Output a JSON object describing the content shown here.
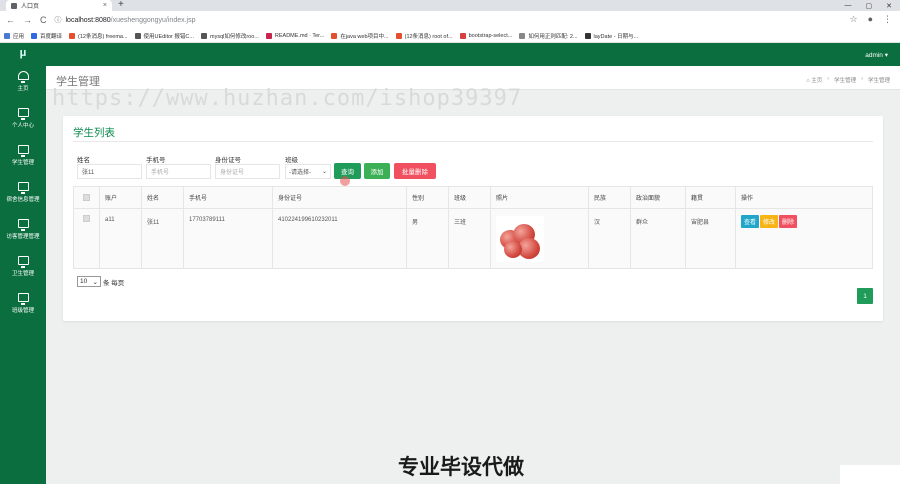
{
  "browser": {
    "tab_title": "人口页",
    "tab_close": "×",
    "new_tab": "+",
    "window_controls": [
      "—",
      "▢",
      "✕"
    ],
    "nav": [
      "←",
      "→",
      "C"
    ],
    "url_host": "localhost:8080",
    "url_path": "/xueshenggongyu/index.jsp",
    "addr_icons": [
      "☆",
      "●",
      "⋮"
    ],
    "bookmarks": [
      {
        "label": "应用",
        "color": "#4a7bd0"
      },
      {
        "label": "百度翻译",
        "color": "#2f6ae0"
      },
      {
        "label": "(12条消息) freema...",
        "color": "#e3502d"
      },
      {
        "label": "使用UEditor 报错C...",
        "color": "#555555"
      },
      {
        "label": "mysql如何修改roo...",
        "color": "#555555"
      },
      {
        "label": "README.md · Ter...",
        "color": "#c7254e"
      },
      {
        "label": "在java web项目中...",
        "color": "#e3502d"
      },
      {
        "label": "(12条消息) root of...",
        "color": "#e3502d"
      },
      {
        "label": "bootstrap-select...",
        "color": "#d64040"
      },
      {
        "label": "如何用正则匹配: 2...",
        "color": "#888888"
      },
      {
        "label": "layDate - 日期与...",
        "color": "#333333"
      }
    ]
  },
  "sidebar": {
    "logo": "μ",
    "items": [
      {
        "label": "主页"
      },
      {
        "label": "个人中心"
      },
      {
        "label": "学生管理"
      },
      {
        "label": "宿舍信息管理"
      },
      {
        "label": "访客管理管理"
      },
      {
        "label": "卫生管理"
      },
      {
        "label": "班级管理"
      }
    ]
  },
  "header": {
    "user": "admin ▾"
  },
  "page": {
    "title": "学生管理",
    "breadcrumb": [
      "⌂ 主页",
      "›",
      "学生管理",
      "›",
      "学生管理"
    ],
    "watermark": "https://www.huzhan.com/ishop39397"
  },
  "panel": {
    "title": "学生列表",
    "filters": {
      "name_label": "姓名",
      "name_value": "张11",
      "phone_label": "手机号",
      "phone_placeholder": "手机号",
      "idcard_label": "身份证号",
      "idcard_placeholder": "身份证号",
      "class_label": "班级",
      "class_selected": "-请选择-",
      "class_chevron": "⌄"
    },
    "buttons": {
      "search": "查询",
      "add": "添加",
      "batch_delete": "批量删除"
    },
    "table": {
      "headers": [
        "",
        "账户",
        "姓名",
        "手机号",
        "身份证号",
        "性别",
        "班级",
        "照片",
        "民族",
        "政治面貌",
        "籍贯",
        "操作"
      ],
      "rows": [
        {
          "account": "a11",
          "name": "张11",
          "phone": "17703789111",
          "idcard": "410224199610232011",
          "gender": "男",
          "class": "三班",
          "ethnicity": "汉",
          "political": "群众",
          "origin": "宙肥县"
        }
      ],
      "row_actions": {
        "view": "查看",
        "edit": "修改",
        "delete": "删除"
      }
    },
    "pager": {
      "page_size": "10",
      "page_size_chevron": "⌄",
      "page_size_suffix": "条 每页",
      "current_page": "1"
    }
  },
  "overlay": {
    "text": "专业毕设代做"
  },
  "colors": {
    "primary": "#0b6e3f",
    "accent": "#1f9b5a",
    "danger": "#f0505f",
    "warning": "#f6b417",
    "info": "#1fa6c8"
  }
}
